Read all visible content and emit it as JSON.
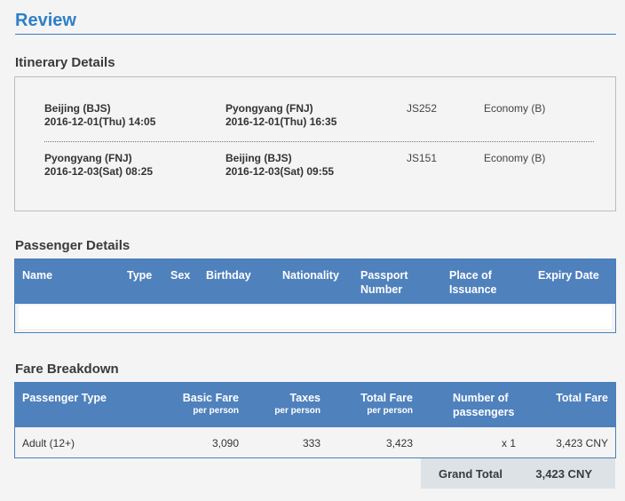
{
  "page": {
    "title": "Review"
  },
  "itinerary": {
    "title": "Itinerary Details",
    "segments": [
      {
        "from_city": "Beijing (BJS)",
        "from_time": "2016-12-01(Thu) 14:05",
        "to_city": "Pyongyang (FNJ)",
        "to_time": "2016-12-01(Thu) 16:35",
        "flight": "JS252",
        "cabin": "Economy (B)"
      },
      {
        "from_city": "Pyongyang (FNJ)",
        "from_time": "2016-12-03(Sat) 08:25",
        "to_city": "Beijing (BJS)",
        "to_time": "2016-12-03(Sat) 09:55",
        "flight": "JS151",
        "cabin": "Economy (B)"
      }
    ]
  },
  "passengers": {
    "title": "Passenger Details",
    "columns": {
      "name": "Name",
      "type": "Type",
      "sex": "Sex",
      "birthday": "Birthday",
      "nationality": "Nationality",
      "passport_1": "Passport",
      "passport_2": "Number",
      "place_1": "Place of",
      "place_2": "Issuance",
      "expiry": "Expiry Date"
    }
  },
  "fare": {
    "title": "Fare Breakdown",
    "columns": {
      "passenger_type": "Passenger Type",
      "basic_fare": "Basic Fare",
      "basic_fare_sub": "per person",
      "taxes": "Taxes",
      "taxes_sub": "per person",
      "total_fare": "Total Fare",
      "total_fare_sub": "per person",
      "num_1": "Number of",
      "num_2": "passengers",
      "total": "Total Fare"
    },
    "rows": [
      {
        "passenger_type": "Adult (12+)",
        "basic_fare": "3,090",
        "taxes": "333",
        "total_fare": "3,423",
        "count": "x 1",
        "total": "3,423 CNY"
      }
    ],
    "grand_total_label": "Grand Total",
    "grand_total_value": "3,423 CNY"
  },
  "colors": {
    "accent": "#2f7fc6",
    "table_header": "#4f81bd",
    "grand_total_bg": "#dde2e6"
  }
}
